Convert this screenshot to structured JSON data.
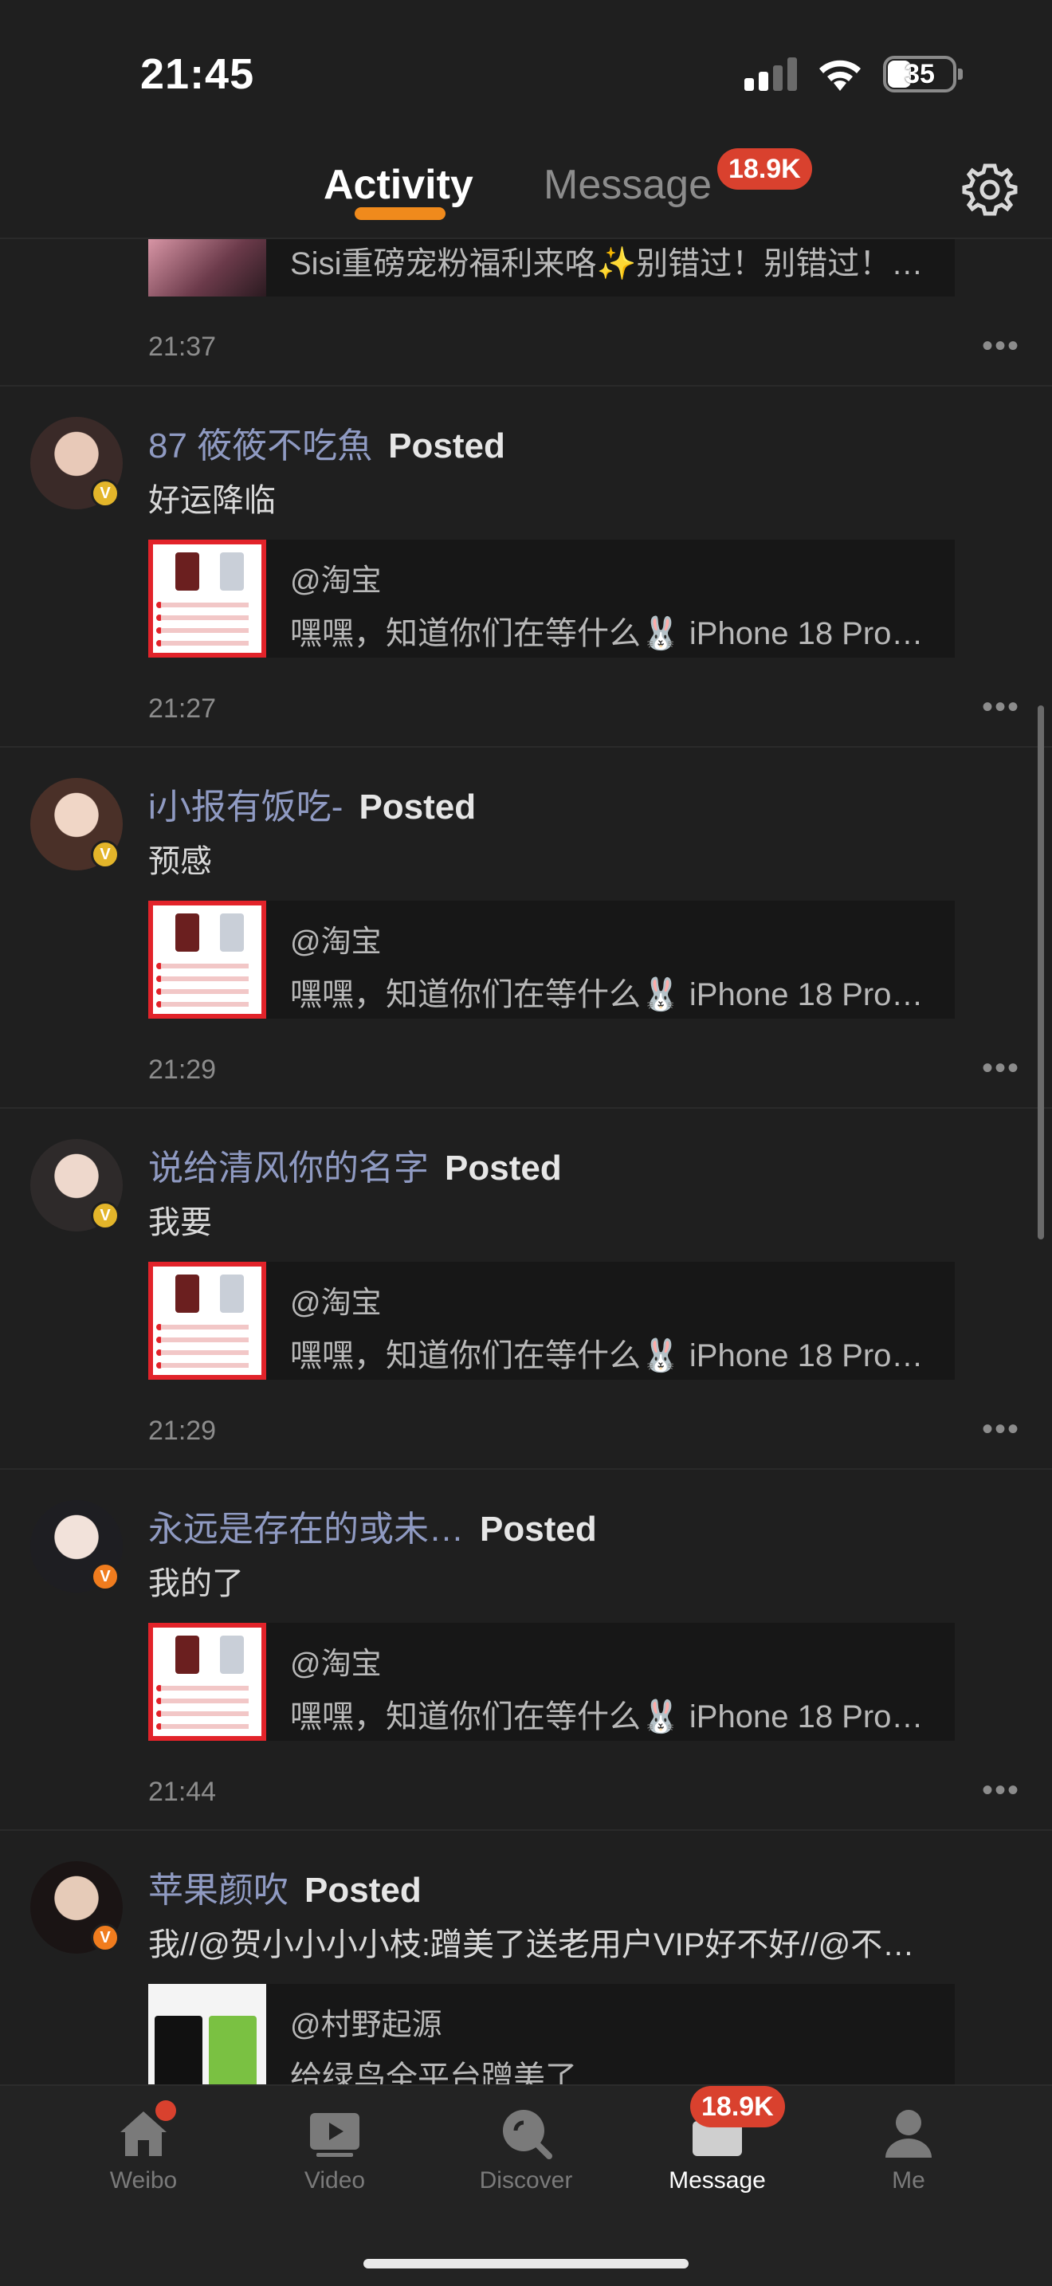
{
  "status_bar": {
    "time": "21:45",
    "battery": "35"
  },
  "header": {
    "tabs": [
      {
        "label": "Activity"
      },
      {
        "label": "Message"
      }
    ],
    "message_badge": "18.9K",
    "accent_color": "#f08a1c"
  },
  "top_card": {
    "text": "Sisi重磅宠粉福利来咯✨别错过！别错过！…",
    "time": "21:37"
  },
  "feed": [
    {
      "name": "87 筱筱不吃魚",
      "action": "Posted",
      "text": "好运降临",
      "card_title": "@淘宝",
      "card_desc": "嘿嘿，知道你们在等什么🐰 iPhone 18 Pro…",
      "time": "21:27",
      "badge_color": "gold"
    },
    {
      "name": "i小报有饭吃-",
      "action": "Posted",
      "text": "预感",
      "card_title": "@淘宝",
      "card_desc": "嘿嘿，知道你们在等什么🐰 iPhone 18 Pro…",
      "time": "21:29",
      "badge_color": "gold"
    },
    {
      "name": "说给清风你的名字",
      "action": "Posted",
      "text": "我要",
      "card_title": "@淘宝",
      "card_desc": "嘿嘿，知道你们在等什么🐰 iPhone 18 Pro…",
      "time": "21:29",
      "badge_color": "gold"
    },
    {
      "name": "永远是存在的或未…",
      "action": "Posted",
      "text": "我的了",
      "card_title": "@淘宝",
      "card_desc": "嘿嘿，知道你们在等什么🐰 iPhone 18 Pro…",
      "time": "21:44",
      "badge_color": "orange"
    },
    {
      "name": "苹果颜吹",
      "action": "Posted",
      "text": "我//@贺小小小小枝:蹭美了送老用户VIP好不好//@不…",
      "card_title": "@村野起源",
      "card_desc": "给绿鸟全平台蹭美了",
      "badge_color": "orange"
    }
  ],
  "tabbar": {
    "items": [
      {
        "label": "Weibo",
        "icon": "home-icon"
      },
      {
        "label": "Video",
        "icon": "video-icon"
      },
      {
        "label": "Discover",
        "icon": "discover-icon"
      },
      {
        "label": "Message",
        "icon": "message-icon"
      },
      {
        "label": "Me",
        "icon": "person-icon"
      }
    ],
    "message_badge": "18.9K"
  }
}
